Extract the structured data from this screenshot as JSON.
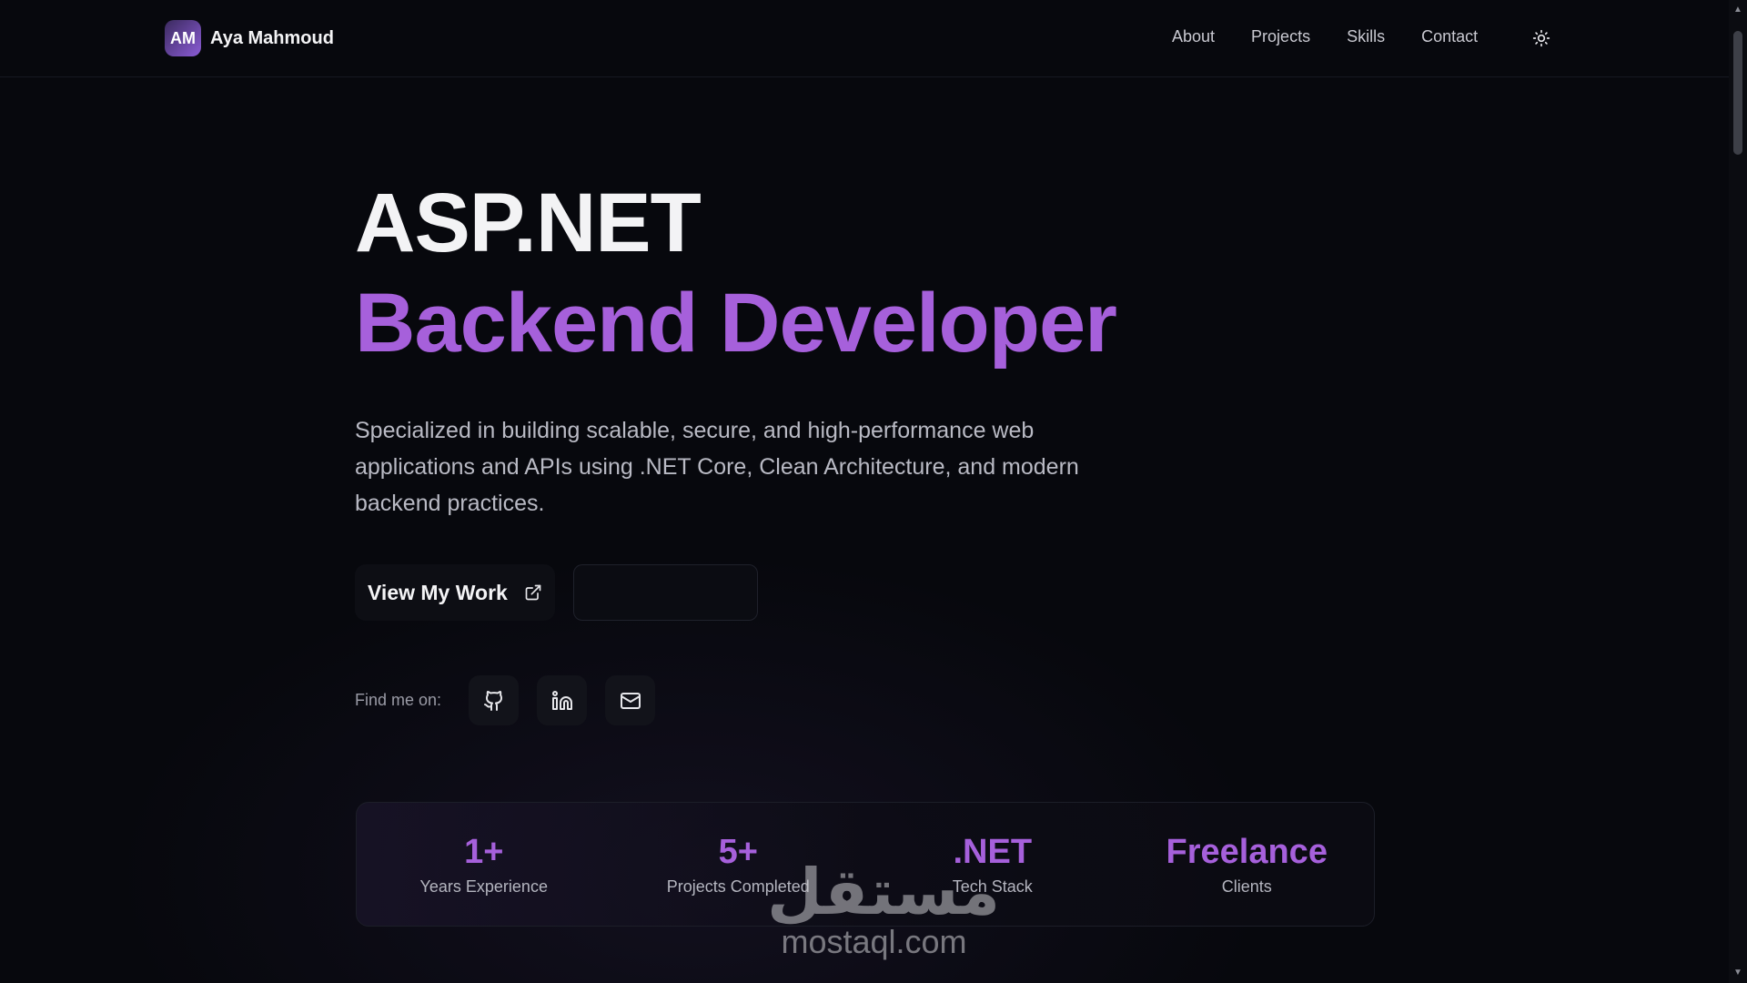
{
  "header": {
    "brand_initials": "AM",
    "brand_name": "Aya Mahmoud",
    "nav": [
      "About",
      "Projects",
      "Skills",
      "Contact"
    ],
    "theme_icon": "sun-icon"
  },
  "hero": {
    "title_line1": "ASP.NET",
    "title_line2": "Backend Developer",
    "description": "Specialized in building scalable, secure, and high-performance web applications and APIs using .NET Core, Clean Architecture, and modern backend practices.",
    "primary_button": "View My Work",
    "primary_button_icon": "external-link-icon",
    "secondary_button": "",
    "find_label": "Find me on:",
    "social_icons": [
      "github-icon",
      "linkedin-icon",
      "mail-icon"
    ]
  },
  "stats": [
    {
      "value": "1+",
      "label": "Years Experience"
    },
    {
      "value": "5+",
      "label": "Projects Completed"
    },
    {
      "value": ".NET",
      "label": "Tech Stack"
    },
    {
      "value": "Freelance",
      "label": "Clients"
    }
  ],
  "watermark": {
    "arabic": "مستقل",
    "latin": "mostaql.com"
  },
  "colors": {
    "background": "#07080d",
    "accent": "#a660db",
    "text": "#f3f3f5",
    "muted": "#b9bac4"
  }
}
